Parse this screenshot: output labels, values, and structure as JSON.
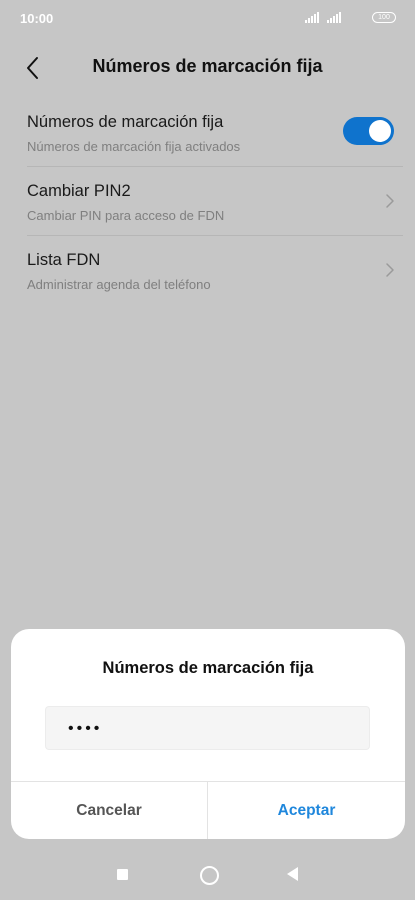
{
  "status_bar": {
    "time": "10:00",
    "battery": "100"
  },
  "header": {
    "title": "Números de marcación fija",
    "back_icon": "chevron-left-icon"
  },
  "settings": {
    "items": [
      {
        "title": "Números de marcación fija",
        "subtitle": "Números de marcación fija activados",
        "control": "toggle",
        "toggle_on": true
      },
      {
        "title": "Cambiar PIN2",
        "subtitle": "Cambiar PIN para acceso de FDN",
        "control": "chevron-right-icon"
      },
      {
        "title": "Lista FDN",
        "subtitle": "Administrar agenda del teléfono",
        "control": "chevron-right-icon"
      }
    ]
  },
  "dialog": {
    "title": "Números de marcación fija",
    "pin_value": "••••",
    "cancel_label": "Cancelar",
    "accept_label": "Aceptar"
  },
  "nav_bar": {
    "icons": [
      "recents-square-icon",
      "home-circle-icon",
      "back-triangle-icon"
    ]
  },
  "colors": {
    "accent": "#1f87dc",
    "toggle_on": "#0f73cd",
    "scrim_background": "#c6c6c6",
    "dialog_background": "#ffffff"
  }
}
